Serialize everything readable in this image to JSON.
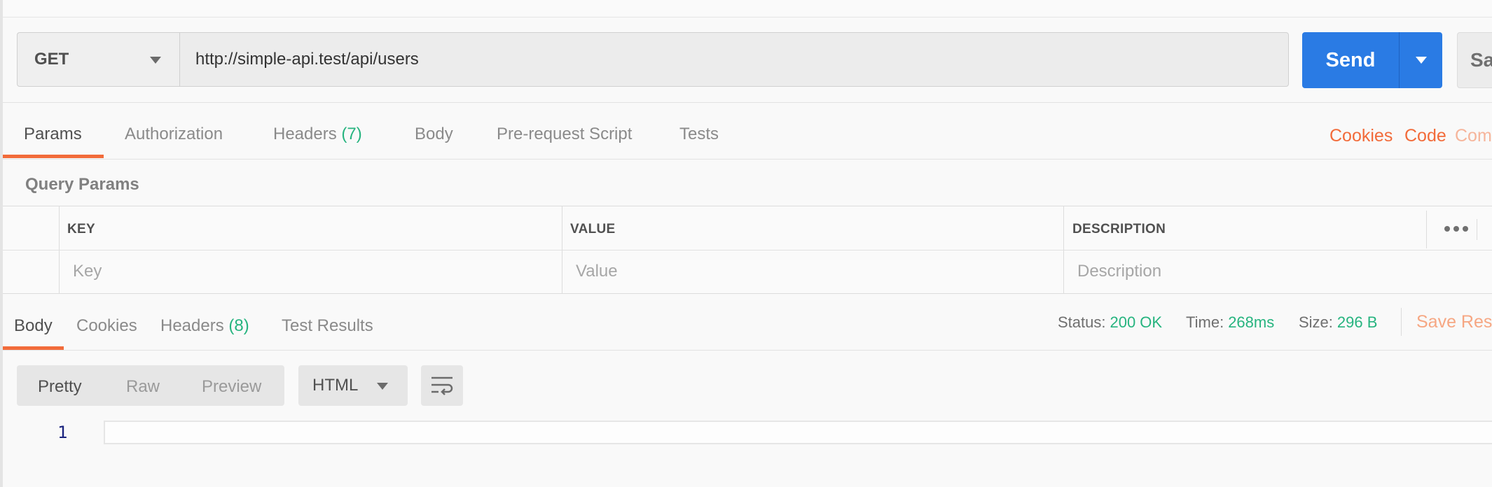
{
  "request": {
    "method": "GET",
    "url": "http://simple-api.test/api/users",
    "send_label": "Send",
    "save_label": "Sa"
  },
  "request_tabs": [
    {
      "label": "Params",
      "active": true
    },
    {
      "label": "Authorization"
    },
    {
      "label": "Headers",
      "count": "(7)"
    },
    {
      "label": "Body"
    },
    {
      "label": "Pre-request Script"
    },
    {
      "label": "Tests"
    }
  ],
  "request_links": {
    "cookies": "Cookies",
    "code": "Code",
    "comments": "Com"
  },
  "query_params": {
    "title": "Query Params",
    "columns": [
      "KEY",
      "VALUE",
      "DESCRIPTION"
    ],
    "placeholders": {
      "key": "Key",
      "value": "Value",
      "description": "Description"
    }
  },
  "response_tabs": [
    {
      "label": "Body",
      "active": true
    },
    {
      "label": "Cookies"
    },
    {
      "label": "Headers",
      "count": "(8)"
    },
    {
      "label": "Test Results"
    }
  ],
  "response_status": {
    "status_label": "Status:",
    "status_value": "200 OK",
    "time_label": "Time:",
    "time_value": "268ms",
    "size_label": "Size:",
    "size_value": "296 B",
    "save_response": "Save Resp"
  },
  "body_toolbar": {
    "formats": [
      "Pretty",
      "Raw",
      "Preview"
    ],
    "active_format": "Pretty",
    "language": "HTML"
  },
  "editor": {
    "line_numbers": [
      "1"
    ]
  },
  "colors": {
    "accent": "#f26b3a",
    "send": "#2a7be4",
    "success": "#26b47f"
  },
  "icons": {
    "method_caret": "chevron-down-icon",
    "send_caret": "chevron-down-icon",
    "more": "more-horizontal-icon",
    "wrap": "wrap-lines-icon"
  }
}
